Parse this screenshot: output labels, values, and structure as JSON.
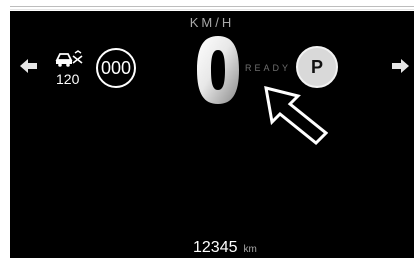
{
  "dashboard": {
    "speed_unit": "KM/H",
    "speed": "0",
    "ready_label": "READY",
    "gear": "P",
    "cruise_speed": "120",
    "odo_circle": "000",
    "odometer_value": "12345",
    "odometer_unit": "km"
  },
  "icons": {
    "left_nav": "arrow-left-icon",
    "right_nav": "arrow-right-icon",
    "cruise": "adaptive-cruise-icon",
    "pointer": "pointer-arrow-icon"
  },
  "colors": {
    "background": "#000000",
    "text_primary": "#ffffff",
    "text_muted": "#a9a9a9",
    "gear_badge": "#d9d9d9"
  }
}
